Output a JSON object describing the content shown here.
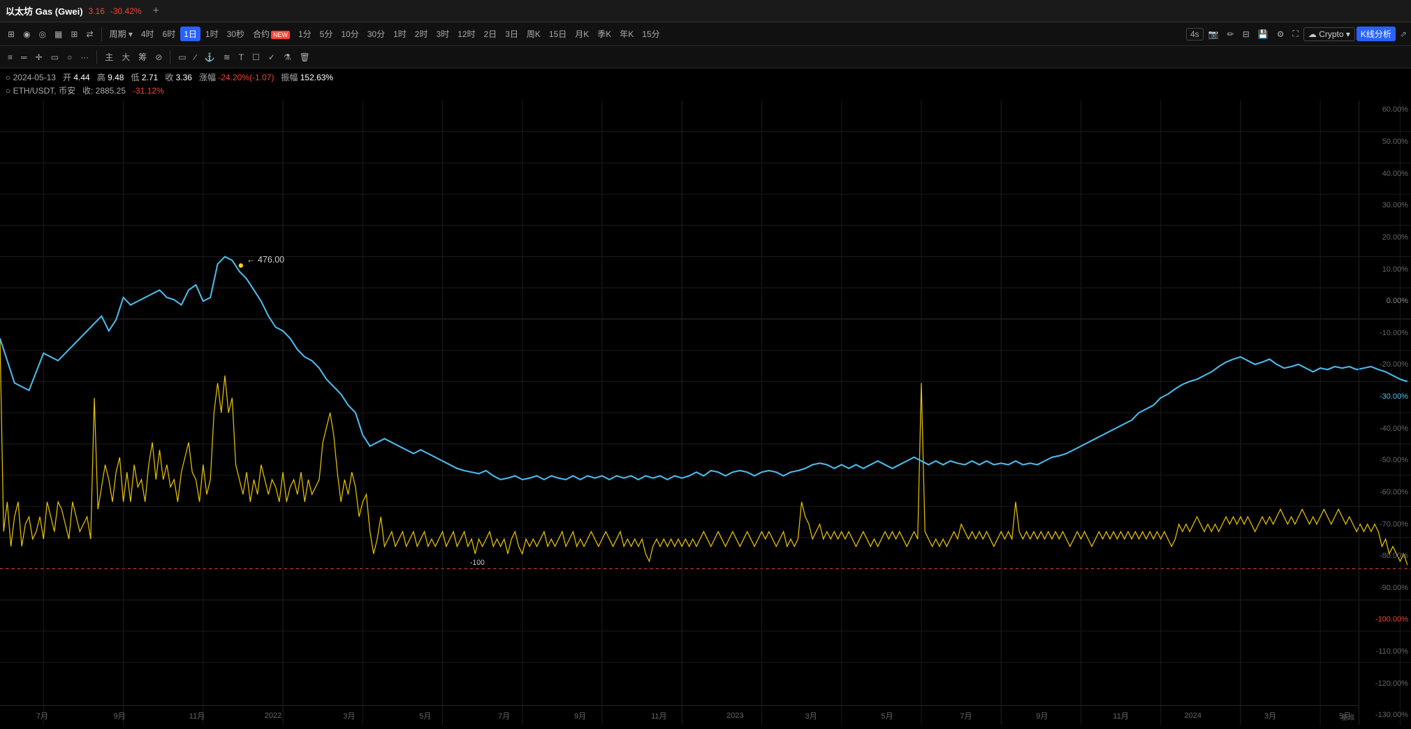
{
  "title": {
    "instrument": "以太坊 Gas (Gwei)",
    "price": "3.16",
    "change": "-30.42%",
    "add_btn": "+"
  },
  "toolbar1": {
    "icons": [
      "layout",
      "indicator",
      "alert",
      "candle",
      "table",
      "compare"
    ],
    "period_label": "周期",
    "periods": [
      "4时",
      "6时",
      "1日",
      "1时",
      "30秒",
      "合约",
      "1分",
      "5分",
      "10分",
      "30分",
      "1时",
      "2时",
      "3时",
      "12时",
      "2日",
      "3日",
      "周K",
      "15日",
      "月K",
      "季K",
      "年K",
      "15分"
    ],
    "active_period": "1日",
    "right_controls": {
      "replay": "4s",
      "photo": "📷",
      "draw": "✏",
      "layout": "⊞",
      "save": "💾",
      "settings": "⚙",
      "fullscreen": "⛶",
      "crypto": "Crypto",
      "kline": "K线分析",
      "share": "⇗"
    }
  },
  "toolbar2": {
    "tools": [
      "三横",
      "两横",
      "十字",
      "矩形",
      "圆形",
      "点线",
      "主",
      "大",
      "筹",
      "编辑",
      "画线",
      "锚点",
      "路径",
      "波浪",
      "文字",
      "矩形2",
      "勾",
      "删除",
      "清空"
    ]
  },
  "info_rows": {
    "row1": {
      "date": "2024-05-13",
      "open_label": "开",
      "open": "4.44",
      "high_label": "高",
      "high": "9.48",
      "low_label": "低",
      "low": "2.71",
      "close_label": "收",
      "close": "3.36",
      "change_label": "涨幅",
      "change": "-24.20%(-1.07)",
      "amplitude_label": "振幅",
      "amplitude": "152.63%"
    },
    "row2": {
      "symbol": "ETH/USDT",
      "exchange": "币安",
      "close_label": "收:",
      "close": "2885.25",
      "change": "-31.12%"
    }
  },
  "chart": {
    "y_labels": [
      "60.00%",
      "50.00%",
      "40.00%",
      "30.00%",
      "20.00%",
      "10.00%",
      "0.00%",
      "-10.00%",
      "-20.00%",
      "-30.00%",
      "-40.00%",
      "-50.00%",
      "-60.00%",
      "-70.00%",
      "-80.00%",
      "-90.00%",
      "-100.00%",
      "-110.00%",
      "-120.00%",
      "-130.00%"
    ],
    "x_labels": [
      "7月",
      "9月",
      "11月",
      "2022",
      "3月",
      "5月",
      "7月",
      "9月",
      "11月",
      "2023",
      "3月",
      "5月",
      "7月",
      "9月",
      "11月",
      "2024",
      "3月",
      "5月"
    ],
    "annotation": {
      "value": "476.00",
      "label": "← 476.00"
    },
    "annotation2": {
      "value": "-100",
      "label": "-100"
    }
  },
  "colors": {
    "blue_line": "#4fc3f7",
    "yellow_line": "#ffd700",
    "red_dashed": "#f44336",
    "background": "#000000",
    "grid": "#1a1a1a",
    "active_btn": "#2962ff"
  }
}
